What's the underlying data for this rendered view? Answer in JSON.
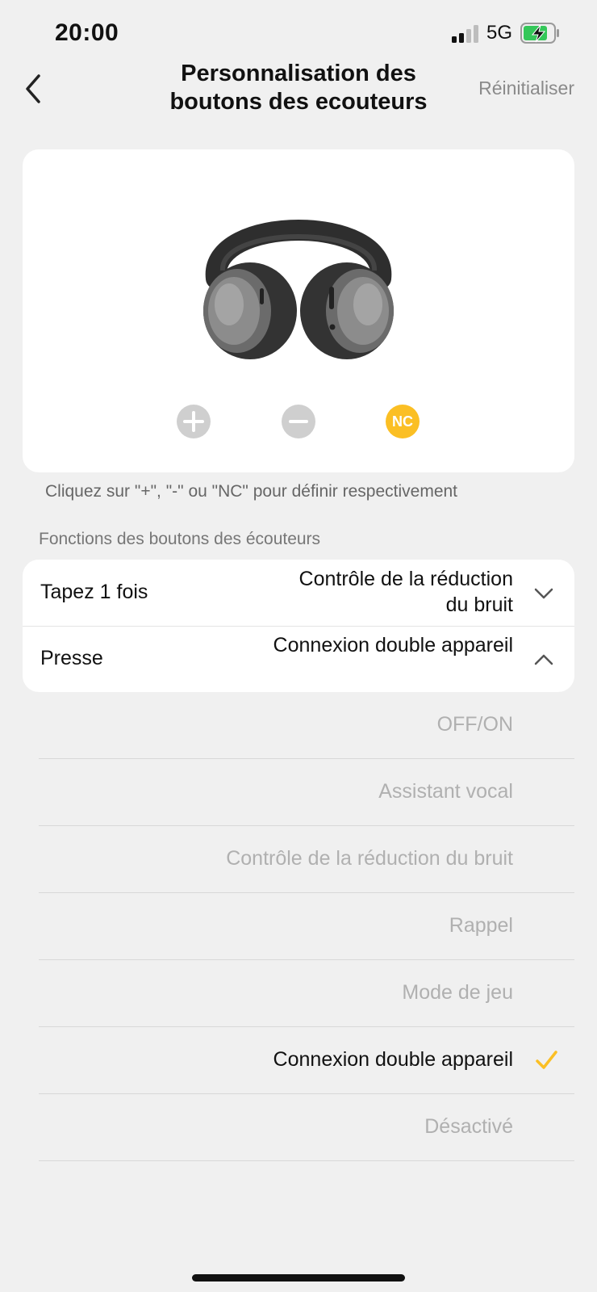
{
  "status_bar": {
    "time": "20:00",
    "network": "5G",
    "signal_icon": "signal-bars-icon",
    "battery_icon": "battery-charging-icon",
    "battery_color": "#34c759"
  },
  "nav": {
    "back_icon": "chevron-left-icon",
    "title": "Personnalisation des boutons des ecouteurs",
    "reset_label": "Réinitialiser"
  },
  "product": {
    "image": "headphones-image",
    "buttons": [
      {
        "icon": "plus-icon"
      },
      {
        "icon": "minus-icon"
      },
      {
        "label": "NC",
        "color": "#fbbf24"
      }
    ]
  },
  "hint": "Cliquez sur \"+\", \"-\" ou \"NC\" pour définir respectivement",
  "section_label": "Fonctions des boutons des écouteurs",
  "functions": [
    {
      "name": "Tapez 1 fois",
      "value": "Contrôle de la réduction du bruit",
      "state": "collapsed"
    },
    {
      "name": "Presse",
      "value": "Connexion double appareil",
      "state": "expanded"
    }
  ],
  "options": [
    {
      "label": "OFF/ON",
      "selected": false
    },
    {
      "label": "Assistant vocal",
      "selected": false
    },
    {
      "label": "Contrôle de la réduction du bruit",
      "selected": false
    },
    {
      "label": "Rappel",
      "selected": false
    },
    {
      "label": "Mode de jeu",
      "selected": false
    },
    {
      "label": "Connexion double appareil",
      "selected": true
    },
    {
      "label": "Désactivé",
      "selected": false
    }
  ],
  "colors": {
    "accent": "#fbbf24",
    "background": "#f0f0f0",
    "muted_text": "#b0b0b0"
  }
}
